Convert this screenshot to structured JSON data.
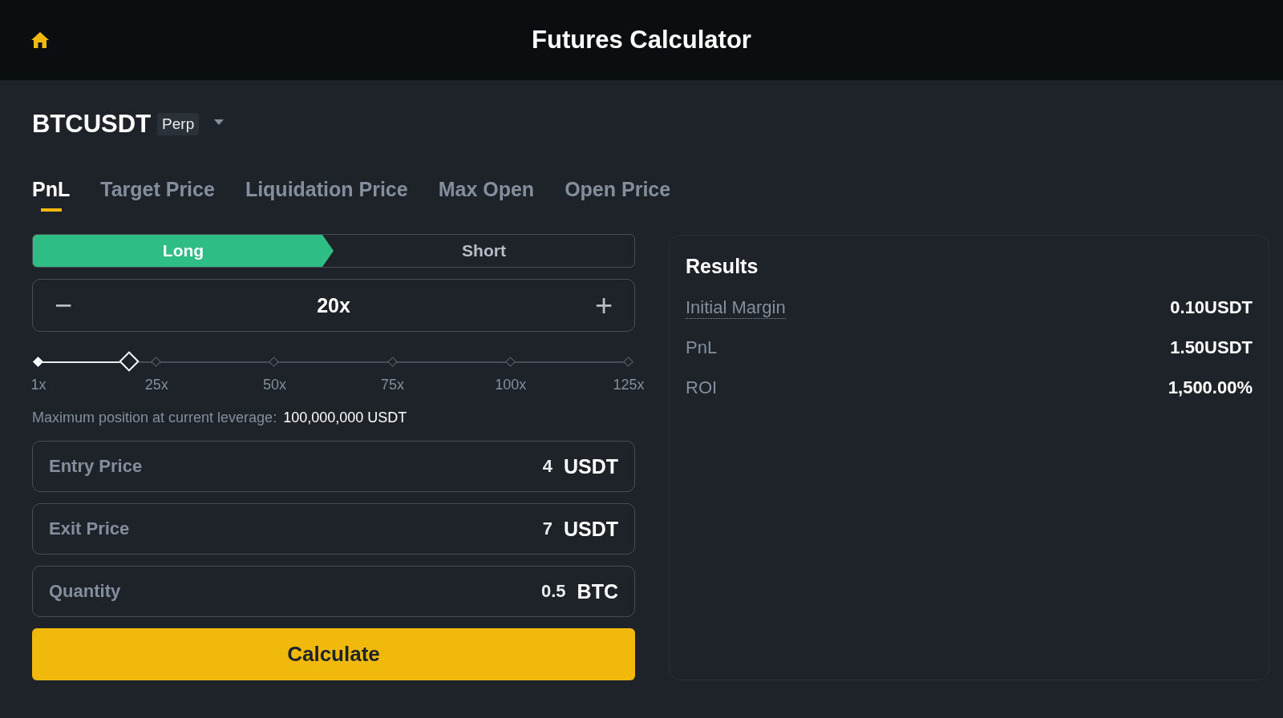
{
  "header": {
    "title": "Futures Calculator"
  },
  "symbol": {
    "name": "BTCUSDT",
    "badge": "Perp"
  },
  "tabs": [
    {
      "label": "PnL",
      "selected": true
    },
    {
      "label": "Target Price",
      "selected": false
    },
    {
      "label": "Liquidation Price",
      "selected": false
    },
    {
      "label": "Max Open",
      "selected": false
    },
    {
      "label": "Open Price",
      "selected": false
    }
  ],
  "sides": [
    {
      "label": "Long",
      "selected": true
    },
    {
      "label": "Short",
      "selected": false
    }
  ],
  "leverage": {
    "minus": "−",
    "value": "20x",
    "plus": "+",
    "level": 0.153,
    "marks": [
      "1x",
      "25x",
      "50x",
      "75x",
      "100x",
      "125x"
    ]
  },
  "max_position": {
    "label": "Maximum position at current leverage:",
    "value": "100,000,000 USDT"
  },
  "fields": [
    {
      "label": "Entry Price",
      "value": "4",
      "unit": "USDT"
    },
    {
      "label": "Exit Price",
      "value": "7",
      "unit": "USDT"
    },
    {
      "label": "Quantity",
      "value": "0.5",
      "unit": "BTC"
    }
  ],
  "calculate_button": "Calculate",
  "results": {
    "title": "Results",
    "rows": [
      {
        "label": "Initial Margin",
        "value": "0.10USDT",
        "dotted": true
      },
      {
        "label": "PnL",
        "value": "1.50USDT",
        "dotted": false
      },
      {
        "label": "ROI",
        "value": "1,500.00%",
        "dotted": false
      }
    ]
  }
}
